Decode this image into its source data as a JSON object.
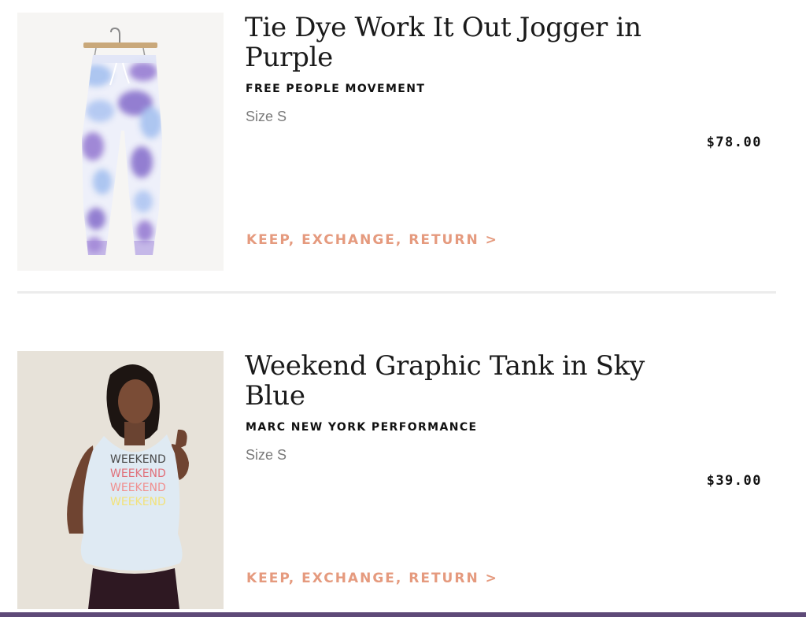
{
  "items": [
    {
      "title": "Tie Dye Work It Out Jogger in Purple",
      "brand": "FREE PEOPLE MOVEMENT",
      "size": "Size S",
      "price": "$78.00",
      "action_label": "KEEP, EXCHANGE, RETURN >",
      "image_name": "tie-dye-jogger-photo"
    },
    {
      "title": "Weekend Graphic Tank in Sky Blue",
      "brand": "MARC NEW YORK PERFORMANCE",
      "size": "Size S",
      "price": "$39.00",
      "action_label": "KEEP, EXCHANGE, RETURN >",
      "image_name": "graphic-tank-photo",
      "shirt_text": [
        "WEEKEND",
        "WEEKEND",
        "WEEKEND",
        "WEEKEND"
      ]
    }
  ],
  "colors": {
    "accent": "#e59a7e",
    "title": "#1a1a1a",
    "size": "#7a7a7a",
    "divider": "#ececec",
    "bottom_bar": "#5e4a78",
    "tie_dye_purple": "#9b82d4",
    "tie_dye_blue": "#a9c3f0"
  }
}
